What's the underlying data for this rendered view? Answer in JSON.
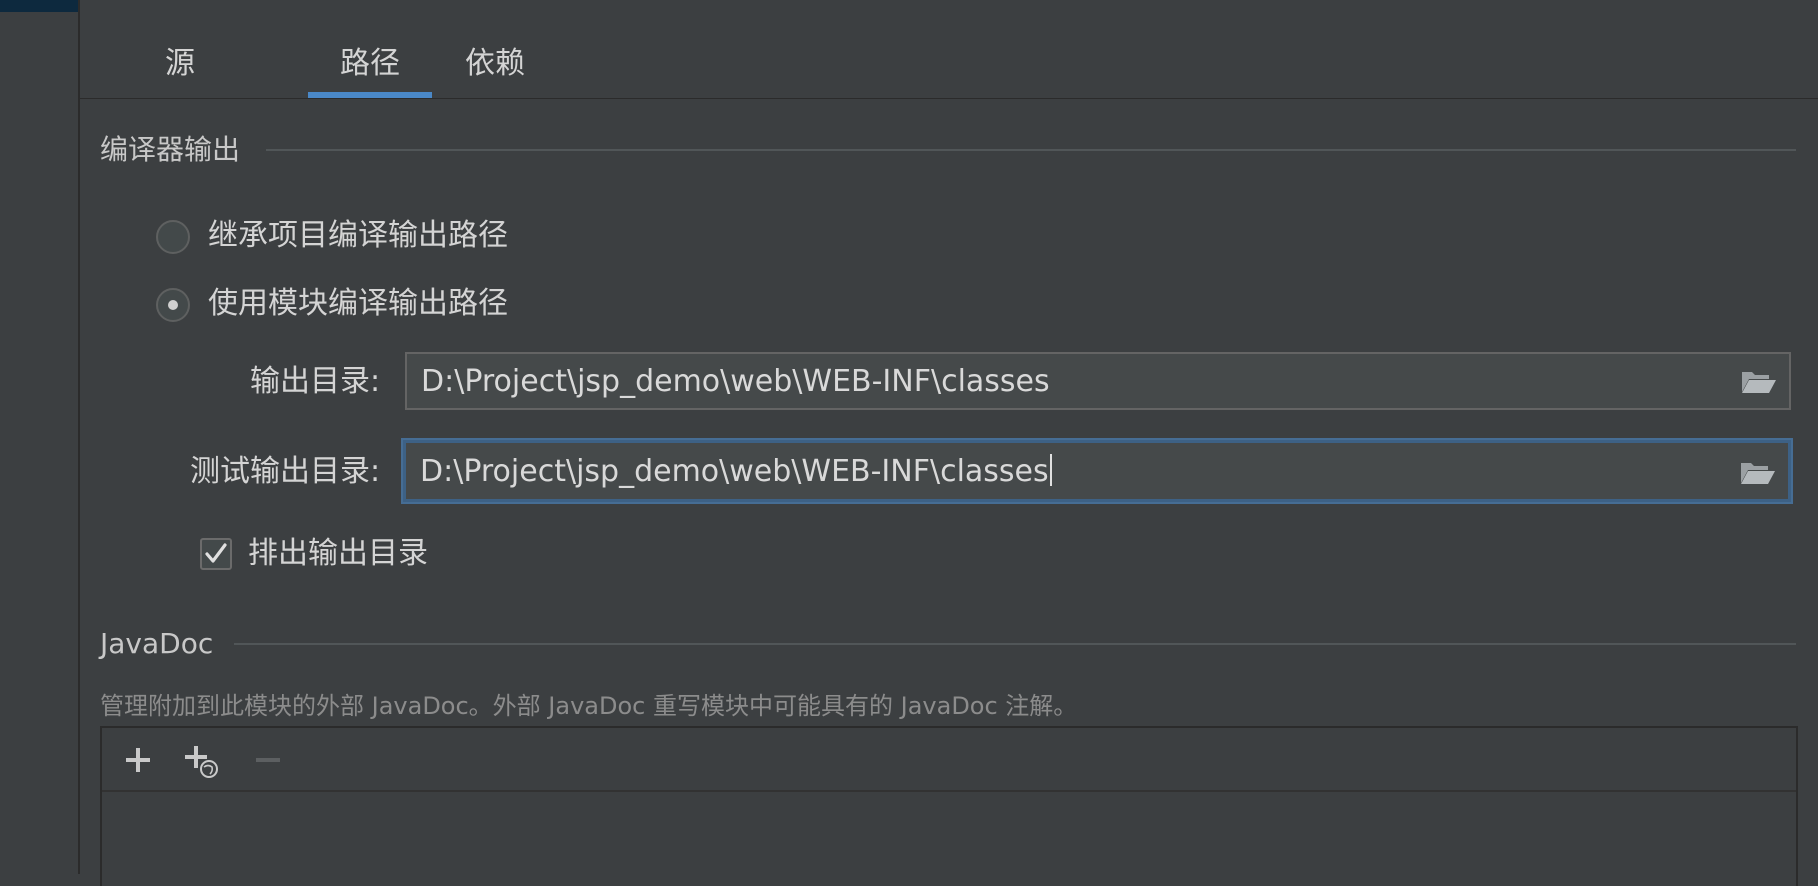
{
  "tabs": [
    {
      "label": "源"
    },
    {
      "label": "路径"
    },
    {
      "label": "依赖"
    }
  ],
  "compiler_output": {
    "title": "编译器输出",
    "inherit_option": "继承项目编译输出路径",
    "module_option": "使用模块编译输出路径",
    "selected": "module_option",
    "output_dir_label": "输出目录:",
    "output_dir_value": "D:\\Project\\jsp_demo\\web\\WEB-INF\\classes",
    "test_output_dir_label": "测试输出目录:",
    "test_output_dir_value": "D:\\Project\\jsp_demo\\web\\WEB-INF\\classes",
    "exclude_label": "排出输出目录",
    "exclude_checked": true
  },
  "javadoc": {
    "title": "JavaDoc",
    "description": "管理附加到此模块的外部 JavaDoc。外部 JavaDoc 重写模块中可能具有的 JavaDoc 注解。"
  },
  "colors": {
    "background": "#3c3f41",
    "accent": "#4a88c7",
    "focus_border": "#3d6185"
  }
}
